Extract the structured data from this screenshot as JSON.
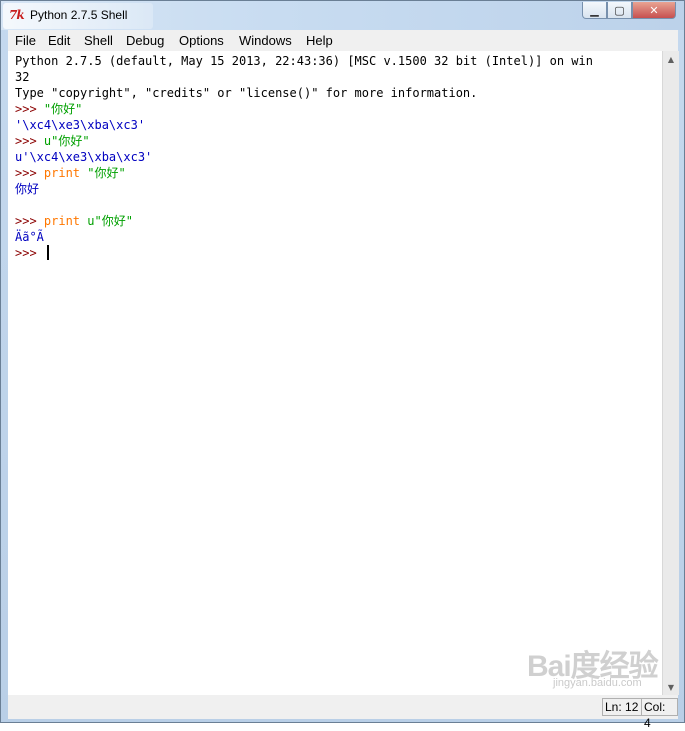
{
  "window": {
    "title": "Python 2.7.5 Shell",
    "icon": "tk-feather-icon",
    "icon_text": "7k"
  },
  "window_controls": {
    "minimize": "▁",
    "maximize": "▢",
    "close": "✕"
  },
  "menu": [
    {
      "label": "File"
    },
    {
      "label": "Edit"
    },
    {
      "label": "Shell"
    },
    {
      "label": "Debug"
    },
    {
      "label": "Options"
    },
    {
      "label": "Windows"
    },
    {
      "label": "Help"
    }
  ],
  "shell": {
    "lines": [
      {
        "segments": [
          {
            "t": "Python 2.7.5 (default, May 15 2013, 22:43:36) [MSC v.1500 32 bit (Intel)] on win",
            "c": "blk"
          }
        ]
      },
      {
        "segments": [
          {
            "t": "32",
            "c": "blk"
          }
        ]
      },
      {
        "segments": [
          {
            "t": "Type \"copyright\", \"credits\" or \"license()\" for more information.",
            "c": "blk"
          }
        ]
      },
      {
        "segments": [
          {
            "t": ">>> ",
            "c": "prm"
          },
          {
            "t": "\"你好\"",
            "c": "str"
          }
        ]
      },
      {
        "segments": [
          {
            "t": "'\\xc4\\xe3\\xba\\xc3'",
            "c": "out"
          }
        ]
      },
      {
        "segments": [
          {
            "t": ">>> ",
            "c": "prm"
          },
          {
            "t": "u\"你好\"",
            "c": "str"
          }
        ]
      },
      {
        "segments": [
          {
            "t": "u'\\xc4\\xe3\\xba\\xc3'",
            "c": "out"
          }
        ]
      },
      {
        "segments": [
          {
            "t": ">>> ",
            "c": "prm"
          },
          {
            "t": "print",
            "c": "kw"
          },
          {
            "t": " \"你好\"",
            "c": "str"
          }
        ]
      },
      {
        "segments": [
          {
            "t": "你好",
            "c": "out"
          }
        ]
      },
      {
        "segments": []
      },
      {
        "segments": [
          {
            "t": ">>> ",
            "c": "prm"
          },
          {
            "t": "print",
            "c": "kw"
          },
          {
            "t": " u\"你好\"",
            "c": "str"
          }
        ]
      },
      {
        "segments": [
          {
            "t": "Äã°Ã",
            "c": "out"
          }
        ]
      },
      {
        "segments": [
          {
            "t": ">>> ",
            "c": "prm"
          }
        ],
        "cursor": true
      }
    ]
  },
  "statusbar": {
    "line": "Ln: 12",
    "col": "Col: 4"
  },
  "watermark": {
    "text": "Bai度经验",
    "sub": "jingyan.baidu.com"
  },
  "colors": {
    "prompt": "#8b0000",
    "string": "#00a000",
    "output": "#0000c0",
    "keyword": "#ff7700"
  }
}
